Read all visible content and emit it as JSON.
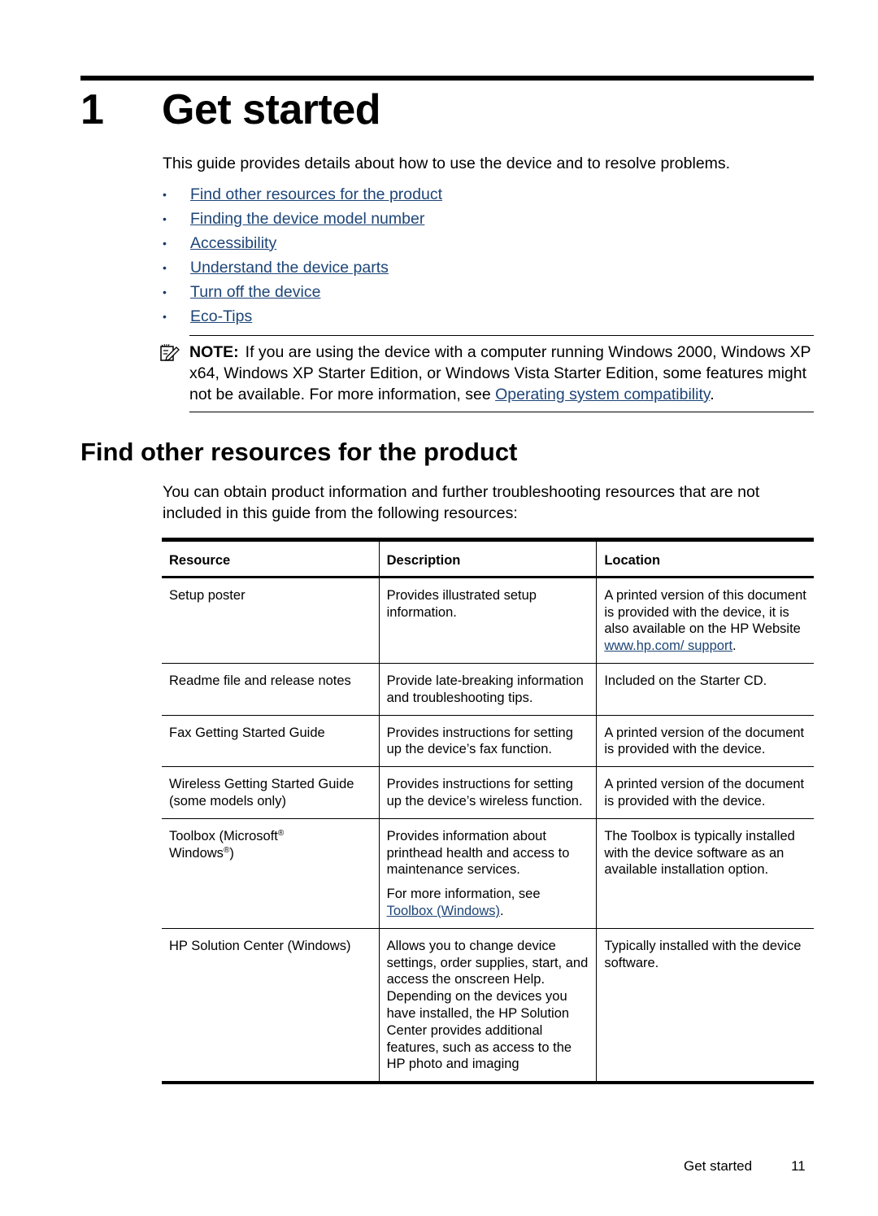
{
  "chapter": {
    "number": "1",
    "title": "Get started"
  },
  "intro": "This guide provides details about how to use the device and to resolve problems.",
  "toc": [
    {
      "label": "Find other resources for the product"
    },
    {
      "label": "Finding the device model number"
    },
    {
      "label": "Accessibility"
    },
    {
      "label": "Understand the device parts"
    },
    {
      "label": "Turn off the device"
    },
    {
      "label": "Eco-Tips"
    }
  ],
  "note": {
    "icon": "note-pencil-icon",
    "label": "NOTE:",
    "text": "If you are using the device with a computer running Windows 2000, Windows XP x64, Windows XP Starter Edition, or Windows Vista Starter Edition, some features might not be available. For more information, see ",
    "link": "Operating system compatibility",
    "end": "."
  },
  "section": {
    "title": "Find other resources for the product",
    "paragraph": "You can obtain product information and further troubleshooting resources that are not included in this guide from the following resources:"
  },
  "table": {
    "headers": [
      "Resource",
      "Description",
      "Location"
    ],
    "rows": [
      {
        "resource": "Setup poster",
        "description": "Provides illustrated setup information.",
        "location": "A printed version of this document is provided with the device, it is also available on the HP Website ",
        "location_link": "www.hp.com/ support",
        "location_end": "."
      },
      {
        "resource": "Readme file and release notes",
        "description": "Provide late-breaking information and troubleshooting tips.",
        "location": "Included on the Starter CD."
      },
      {
        "resource": "Fax Getting Started Guide",
        "description": "Provides instructions for setting up the device’s fax function.",
        "location": "A printed version of the document is provided with the device."
      },
      {
        "resource": "Wireless Getting Started Guide (some models only)",
        "description": "Provides instructions for setting up the device’s wireless function.",
        "location": "A printed version of the document is provided with the device."
      },
      {
        "resource_a": "Toolbox (Microsoft",
        "resource_b": "Windows",
        "resource_c": ")",
        "registered": "®",
        "description": "Provides information about printhead health and access to maintenance services.",
        "description_more": "For more information, see ",
        "description_link": "Toolbox (Windows)",
        "description_end": ".",
        "location": "The Toolbox is typically installed with the device software as an available installation option."
      },
      {
        "resource": "HP Solution Center (Windows)",
        "description": "Allows you to change device settings, order supplies, start, and access the onscreen Help. Depending on the devices you have installed, the HP Solution Center provides additional features, such as access to the HP photo and imaging",
        "location": "Typically installed with the device software."
      }
    ]
  },
  "footer": {
    "section": "Get started",
    "page": "11"
  },
  "colors": {
    "link": "#1d4577",
    "text": "#000000"
  }
}
